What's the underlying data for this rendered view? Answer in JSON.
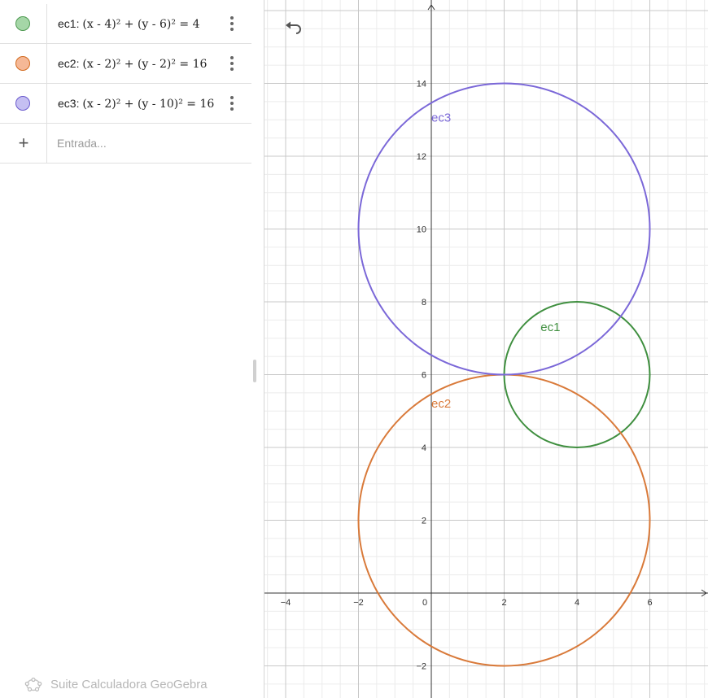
{
  "algebra": {
    "rows": [
      {
        "name": "ec1",
        "lhs": "(x - 4)² + (y - 6)²",
        "rhs": "4",
        "color": "#2e7d32",
        "fill": "#a5d6a7"
      },
      {
        "name": "ec2",
        "lhs": "(x - 2)² + (y - 2)²",
        "rhs": "16",
        "color": "#d2691e",
        "fill": "#f5b896"
      },
      {
        "name": "ec3",
        "lhs": "(x - 2)² + (y - 10)²",
        "rhs": "16",
        "color": "#6a5acd",
        "fill": "#c5bff2"
      }
    ],
    "input_placeholder": "Entrada..."
  },
  "footer": {
    "label": "Suite Calculadora GeoGebra"
  },
  "graph": {
    "x_ticks": [
      "−4",
      "−2",
      "0",
      "2",
      "4",
      "6"
    ],
    "y_ticks": [
      "−2",
      "2",
      "4",
      "6",
      "8",
      "10",
      "12",
      "14"
    ],
    "circles": [
      {
        "label": "ec1",
        "cx": 4,
        "cy": 6,
        "r": 2,
        "color": "#3f8f3f"
      },
      {
        "label": "ec2",
        "cx": 2,
        "cy": 2,
        "r": 4,
        "color": "#d97a3a"
      },
      {
        "label": "ec3",
        "cx": 2,
        "cy": 10,
        "r": 4,
        "color": "#7b68d8"
      }
    ]
  },
  "icons": {
    "undo": "undo-icon",
    "add": "plus-icon",
    "menu": "more-vert-icon",
    "logo": "geogebra-logo-icon"
  }
}
